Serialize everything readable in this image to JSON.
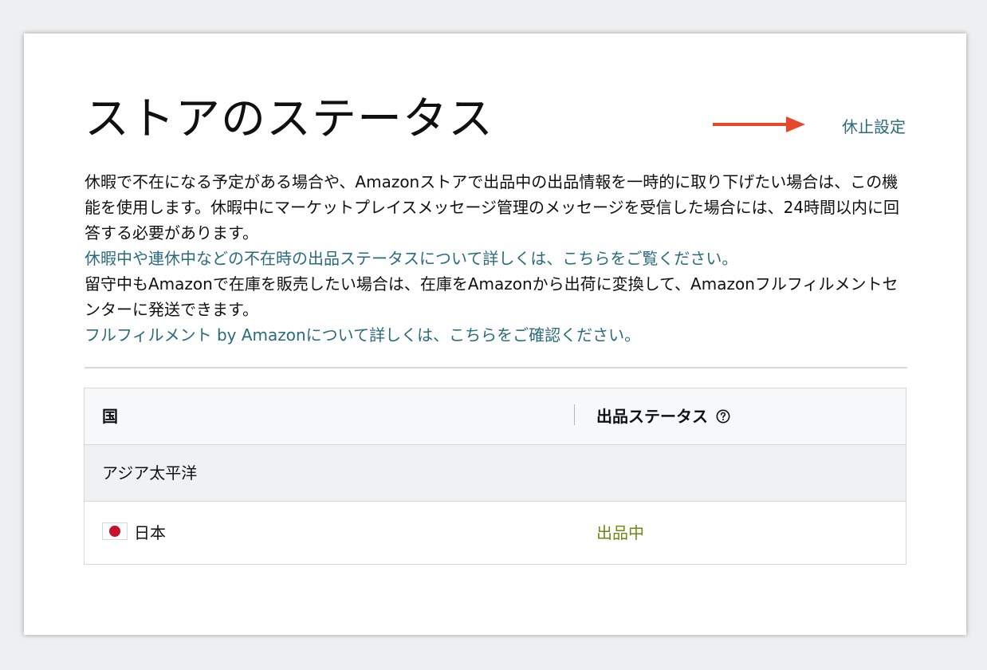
{
  "page": {
    "title": "ストアのステータス",
    "vacation_link": "休止設定"
  },
  "description": {
    "paragraph1": "休暇で不在になる予定がある場合や、Amazonストアで出品中の出品情報を一時的に取り下げたい場合は、この機能を使用します。休暇中にマーケットプレイスメッセージ管理のメッセージを受信した場合には、24時間以内に回答する必要があります。",
    "link1": "休暇中や連休中などの不在時の出品ステータスについて詳しくは、こちらをご覧ください。",
    "paragraph2": "留守中もAmazonで在庫を販売したい場合は、在庫をAmazonから出荷に変換して、Amazonフルフィルメントセンターに発送できます。",
    "link2": "フルフィルメント by Amazonについて詳しくは、こちらをご確認ください。"
  },
  "table": {
    "headers": {
      "country": "国",
      "status": "出品ステータス"
    },
    "region": "アジア太平洋",
    "rows": [
      {
        "country": "日本",
        "status": "出品中"
      }
    ]
  },
  "icons": {
    "arrow": "arrow-right-icon",
    "help": "help-circle-icon",
    "flag": "japan-flag-icon"
  },
  "colors": {
    "link": "#2a6b7d",
    "status_active": "#6b8a13",
    "arrow": "#e8472c"
  }
}
